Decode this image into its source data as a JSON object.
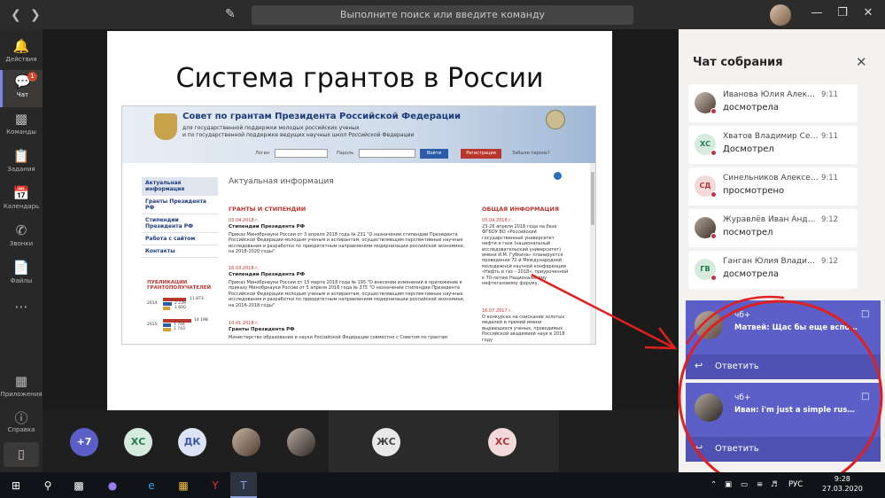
{
  "titlebar": {
    "search_placeholder": "Выполните поиск или введите команду"
  },
  "rail": {
    "items": [
      {
        "label": "Действия",
        "icon": "bell-icon"
      },
      {
        "label": "Чат",
        "icon": "chat-icon",
        "badge": "1"
      },
      {
        "label": "Команды",
        "icon": "teams-icon"
      },
      {
        "label": "Задания",
        "icon": "assignments-icon"
      },
      {
        "label": "Календарь",
        "icon": "calendar-icon"
      },
      {
        "label": "Звонки",
        "icon": "phone-icon"
      },
      {
        "label": "Файлы",
        "icon": "files-icon"
      },
      {
        "label": "Приложения",
        "icon": "apps-icon"
      },
      {
        "label": "Справка",
        "icon": "help-icon"
      }
    ]
  },
  "slide": {
    "title": "Система грантов в России",
    "site": {
      "title": "Совет по грантам Президента Российской Федерации",
      "subtitle_1": "для государственной поддержки молодых российских ученых",
      "subtitle_2": "и по государственной поддержке ведущих научных школ Российской Федерации",
      "login_label": "Логин",
      "password_label": "Пароль",
      "login_button": "Войти",
      "register_button": "Регистрация",
      "forgot_password": "Забыли пароль?",
      "menu": [
        "Актуальная информация",
        "Гранты Президента РФ",
        "Стипендии Президента РФ",
        "Работа с сайтом",
        "Контакты"
      ],
      "main_title": "Актуальная информация",
      "grants_header": "ГРАНТЫ И СТИПЕНДИИ",
      "general_header": "ОБЩАЯ ИНФОРМАЦИЯ",
      "news": [
        {
          "date": "03.04.2018 г.",
          "title": "Стипендии Президента РФ",
          "text": "Приказ Минобрнауки России от 3 апреля 2018 года № 231 \"О назначении стипендии Президента Российской Федерации молодым ученым и аспирантам, осуществляющим перспективные научные исследования и разработки по приоритетным направлениям модернизации российской экономики, на 2018-2020 годы\""
        },
        {
          "date": "16.03.2018 г.",
          "title": "Стипендии Президента РФ",
          "text": "Приказ Минобрнауки России от 15 марта 2018 года № 195 \"О внесении изменений в приложение к приказу Минобрнауки России от 5 апреля 2016 года № 375 \"О назначении стипендии Президента Российской Федерации молодым ученым и аспирантам, осуществляющим перспективные научные исследования и разработки по приоритетным направлениям модернизации российской экономики, на 2016-2018 годы\""
        },
        {
          "date": "10.01.2018 г.",
          "title": "Гранты Президента РФ",
          "text": "Министерство образования и науки Российской Федерации совместно с Советом по грантам"
        }
      ],
      "general_news": [
        {
          "date": "03.04.2018 г.",
          "text": "23-26 апреля 2018 года на базе ФГБОУ ВО «Российский государственный университет нефти и газа (национальный исследовательский университет) имени И.М. Губкина» планируется проведение 72-й Международной молодежной научной конференции «Нефть и газ – 2018», приуроченной к 70-летию Национальному нефтегазовому форуму."
        },
        {
          "date": "16.07.2017 г.",
          "text": "О конкурсах на соискание золотых медалей и премий имени выдающихся ученых, проводимых Российской академией наук в 2018 году"
        }
      ],
      "publications_title": "ПУБЛИКАЦИИ ГРАНТОПОЛУЧАТЕЛЕЙ",
      "publications": [
        {
          "year": "2014",
          "values": [
            "11 873",
            "2 239",
            "1 600"
          ]
        },
        {
          "year": "2015",
          "values": [
            "14 198",
            "1 794",
            "1 743"
          ]
        }
      ]
    }
  },
  "participants": [
    {
      "initials": "+7",
      "color": "#5b5fc7",
      "text_color": "#ffffff"
    },
    {
      "initials": "ХС",
      "color": "#d6ebdd",
      "text_color": "#237b4b"
    },
    {
      "initials": "ДК",
      "color": "#dce3f4",
      "text_color": "#3a5aa6"
    },
    {
      "initials": "",
      "photo": true
    },
    {
      "initials": "",
      "photo": true
    },
    {
      "initials": "ЖС",
      "color": "#e8e8e8",
      "text_color": "#444444"
    },
    {
      "initials": "ХС",
      "color": "#f3dada",
      "text_color": "#a83a3a"
    }
  ],
  "chat": {
    "title": "Чат собрания",
    "messages": [
      {
        "name": "Иванова Юлия Алексеевна",
        "time": "9:11",
        "text": "досмотрела",
        "initials": "",
        "photo": true
      },
      {
        "name": "Хватов Владимир Сергеевич",
        "time": "9:11",
        "text": "Досмотрел",
        "initials": "ХС",
        "color": "#d6ebdd",
        "text_color": "#237b4b"
      },
      {
        "name": "Синельников Алексей Дмитриевич",
        "time": "9:11",
        "text": "просмотрено",
        "initials": "СД",
        "color": "#f3dada",
        "text_color": "#a83a3a"
      },
      {
        "name": "Журавлёв Иван Андреевич",
        "time": "9:12",
        "text": "посмотрел",
        "initials": "",
        "photo": true
      },
      {
        "name": "Ганган Юлия Владимировна",
        "time": "9:12",
        "text": "досмотрела",
        "initials": "ГВ",
        "color": "#d6ebdd",
        "text_color": "#237b4b"
      }
    ]
  },
  "notifications": [
    {
      "name": "чб+",
      "text": "Матвей: Щас бы еще вспомнить",
      "reply": "Ответить"
    },
    {
      "name": "чб+",
      "text": "Иван: i'm just a simple russian girl",
      "reply": "Ответить"
    }
  ],
  "taskbar": {
    "lang": "РУС",
    "time": "9:28",
    "date": "27.03.2020"
  },
  "colors": {
    "accent": "#5b5fc7",
    "reply_bar": "#4f52b2",
    "annotation_red": "#e02020",
    "presence_busy": "#c4314b"
  }
}
